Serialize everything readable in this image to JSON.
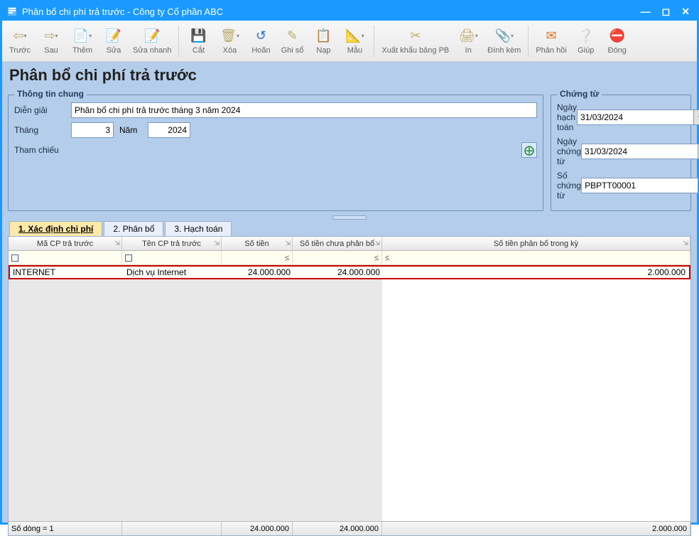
{
  "window": {
    "title": "Phân bổ chi phí trả trước - Công ty Cổ phần ABC"
  },
  "toolbar": {
    "prev": "Trước",
    "next": "Sau",
    "add": "Thêm",
    "edit": "Sửa",
    "quickedit": "Sửa nhanh",
    "cut": "Cắt",
    "delete": "Xóa",
    "undo": "Hoãn",
    "post": "Ghi sổ",
    "load": "Nạp",
    "template": "Mẫu",
    "export": "Xuất khẩu bảng PB",
    "print": "In",
    "attach": "Đính kèm",
    "feedback": "Phản hồi",
    "help": "Giúp",
    "close": "Đóng"
  },
  "page": {
    "title": "Phân bổ chi phí trả trước"
  },
  "info": {
    "legend": "Thông tin chung",
    "desc_label": "Diễn giải",
    "desc": "Phân bổ chi phí trả trước tháng 3 năm 2024",
    "month_label": "Tháng",
    "month": "3",
    "year_label": "Năm",
    "year": "2024",
    "ref_label": "Tham chiếu"
  },
  "doc": {
    "legend": "Chứng từ",
    "postdate_label": "Ngày hạch toán",
    "postdate": "31/03/2024",
    "docdate_label": "Ngày chứng từ",
    "docdate": "31/03/2024",
    "docno_label": "Số chứng từ",
    "docno": "PBPTT00001"
  },
  "tabs": {
    "t1": "1. Xác định chi phí",
    "t2": "2. Phân bổ",
    "t3": "3. Hạch toán"
  },
  "grid": {
    "headers": {
      "c1": "Mã CP trả trước",
      "c2": "Tên CP trả trước",
      "c3": "Số tiền",
      "c4": "Số tiền chưa phân bổ",
      "c5": "Số tiền phân bổ trong kỳ"
    },
    "row": {
      "code": "INTERNET",
      "name": "Dịch vụ Internet",
      "amount": "24.000.000",
      "unalloc": "24.000.000",
      "period": "2.000.000"
    },
    "footer": {
      "rowcount": "Số dòng = 1",
      "sum_amount": "24.000.000",
      "sum_unalloc": "24.000.000",
      "sum_period": "2.000.000"
    },
    "filter_le": "≤"
  }
}
